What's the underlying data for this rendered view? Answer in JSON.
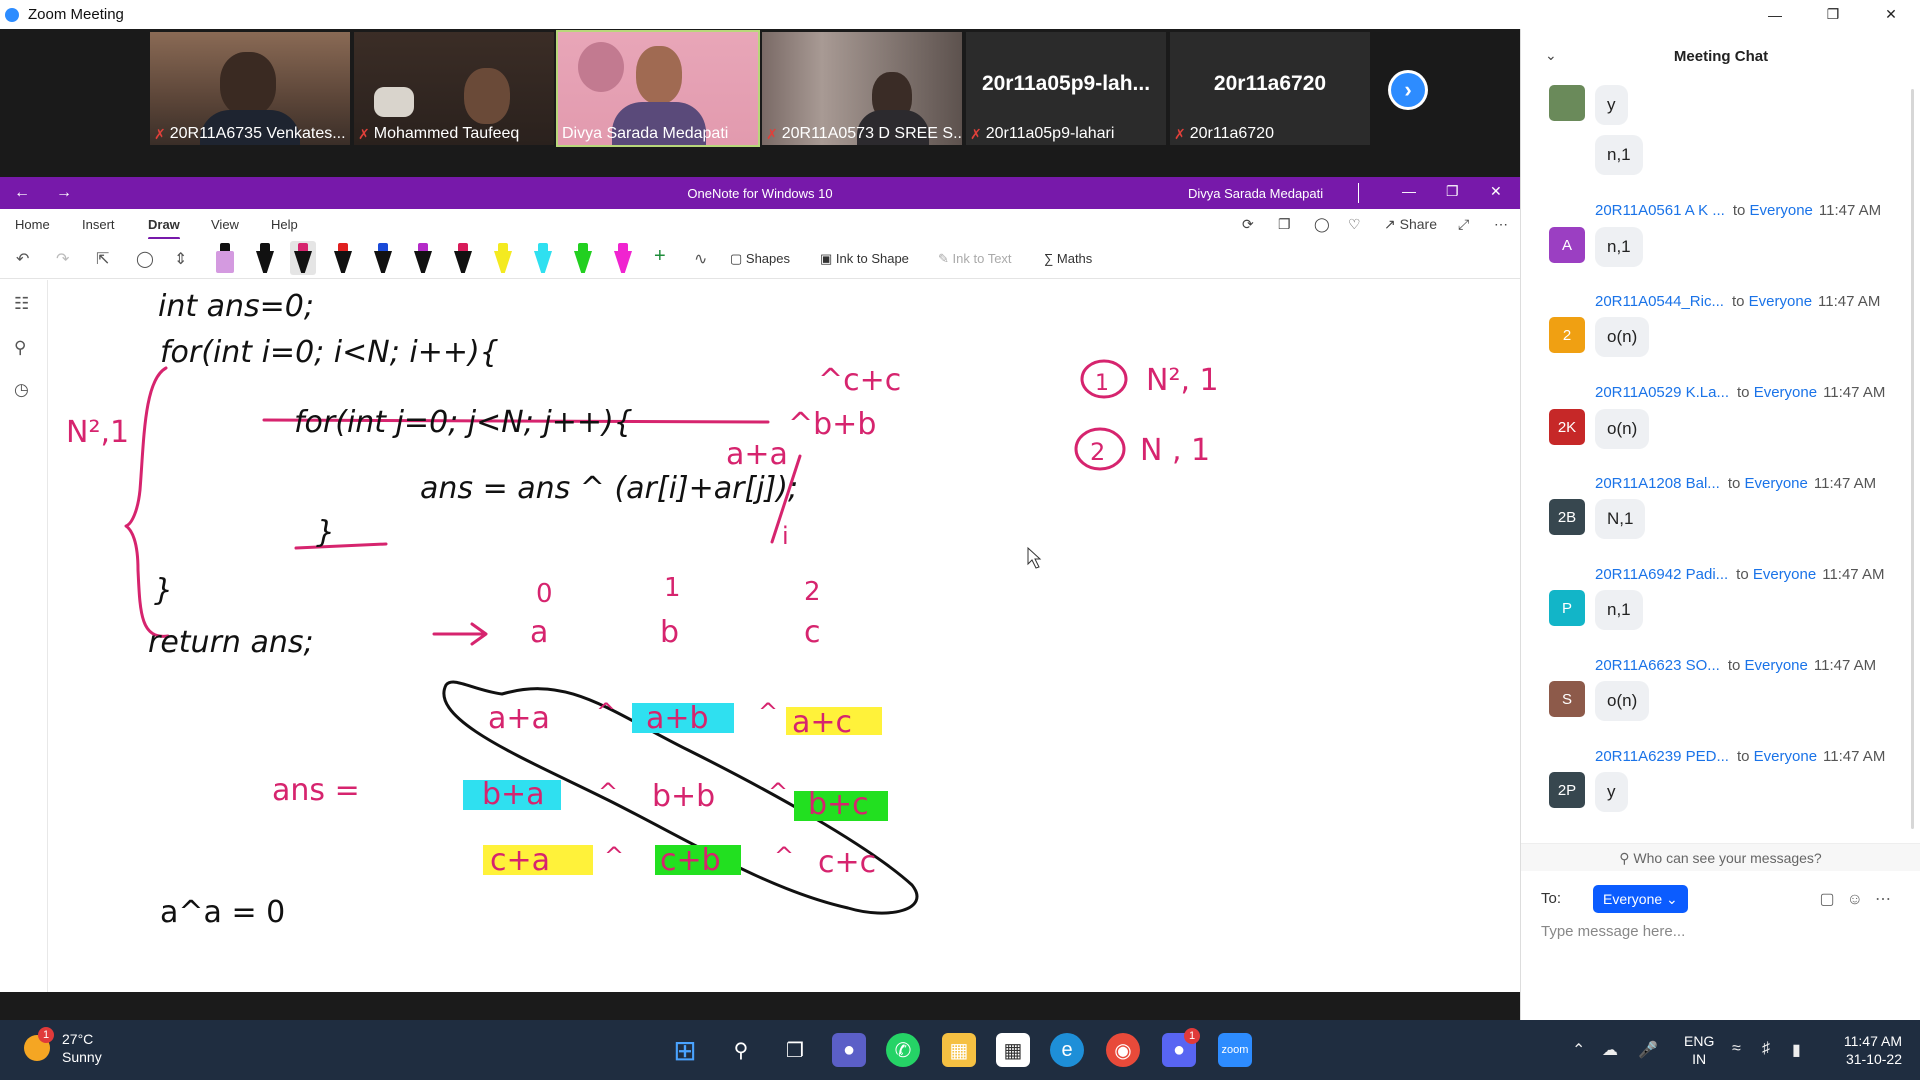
{
  "window": {
    "title": "Zoom Meeting"
  },
  "participants": [
    {
      "name": "20R11A6735 Venkates...",
      "muted": true,
      "video": true
    },
    {
      "name": "Mohammed Taufeeq",
      "muted": true,
      "video": true
    },
    {
      "name": "Divya Sarada Medapati",
      "muted": false,
      "video": true,
      "active_speaker": true
    },
    {
      "name": "20R11A0573 D SREE S...",
      "muted": true,
      "video": true
    },
    {
      "name": "20r11a05p9-lahari",
      "display": "20r11a05p9-lah...",
      "muted": true,
      "video": false
    },
    {
      "name": "20r11a6720",
      "display": "20r11a6720",
      "muted": true,
      "video": false
    }
  ],
  "onenote": {
    "title": "OneNote for Windows 10",
    "user": "Divya Sarada Medapati",
    "tabs": [
      "Home",
      "Insert",
      "Draw",
      "View",
      "Help"
    ],
    "active_tab": "Draw",
    "share_label": "Share",
    "tools": {
      "shapes": "Shapes",
      "ink_to_shape": "Ink to Shape",
      "ink_to_text": "Ink to Text",
      "maths": "Maths"
    }
  },
  "whiteboard": {
    "code": [
      "int ans=0;",
      "for(int i=0; i<N; i++){",
      "for(int j=0; j<N; j++){",
      "ans = ans ^ (ar[i]+ar[j]);",
      "}",
      "}",
      "return ans;"
    ],
    "left_note": "N²,1",
    "top_right_notes": [
      "^c+c",
      "^b+b",
      "a+a"
    ],
    "sub_i": "i",
    "options": [
      {
        "num": "1",
        "text": "N², 1"
      },
      {
        "num": "2",
        "text": "N , 1"
      }
    ],
    "arrow": "→",
    "indices": [
      {
        "i": "0",
        "v": "a"
      },
      {
        "i": "1",
        "v": "b"
      },
      {
        "i": "2",
        "v": "c"
      }
    ],
    "ans_label": "ans =",
    "matrix": [
      [
        "a+a",
        "a+b",
        "a+c"
      ],
      [
        "b+a",
        "b+b",
        "b+c"
      ],
      [
        "c+a",
        "c+b",
        "c+c"
      ]
    ],
    "xor": "^",
    "identity": "a^a = 0",
    "highlight_colors": {
      "cyan": "#2fe0f0",
      "yellow": "#fff23a",
      "green": "#22e020"
    },
    "ink_color": "#d6246e"
  },
  "chat": {
    "title": "Meeting Chat",
    "messages": [
      {
        "sender": "",
        "avatar": "",
        "avatar_color": "#6a8a5a",
        "to": "",
        "time": "",
        "texts": [
          "y",
          "n,1"
        ]
      },
      {
        "sender": "20R11A0561 A K ...",
        "avatar": "A",
        "avatar_color": "#9b3fc2",
        "to": "Everyone",
        "time": "11:47 AM",
        "texts": [
          "n,1"
        ]
      },
      {
        "sender": "20R11A0544_Ric...",
        "avatar": "2",
        "avatar_color": "#f0a012",
        "to": "Everyone",
        "time": "11:47 AM",
        "texts": [
          "o(n)"
        ]
      },
      {
        "sender": "20R11A0529 K.La...",
        "avatar": "2K",
        "avatar_color": "#c62828",
        "to": "Everyone",
        "time": "11:47 AM",
        "texts": [
          "o(n)"
        ]
      },
      {
        "sender": "20R11A1208 Bal...",
        "avatar": "2B",
        "avatar_color": "#37474f",
        "to": "Everyone",
        "time": "11:47 AM",
        "texts": [
          "N,1"
        ]
      },
      {
        "sender": "20R11A6942 Padi...",
        "avatar": "P",
        "avatar_color": "#12b5c8",
        "to": "Everyone",
        "time": "11:47 AM",
        "texts": [
          "n,1"
        ]
      },
      {
        "sender": "20R11A6623 SO...",
        "avatar": "S",
        "avatar_color": "#8d5a4a",
        "to": "Everyone",
        "time": "11:47 AM",
        "texts": [
          "o(n)"
        ]
      },
      {
        "sender": "20R11A6239 PED...",
        "avatar": "2P",
        "avatar_color": "#37474f",
        "to": "Everyone",
        "time": "11:47 AM",
        "texts": [
          "y"
        ]
      }
    ],
    "visibility": "Who can see your messages?",
    "to_label": "To:",
    "recipient": "Everyone",
    "placeholder": "Type message here..."
  },
  "taskbar": {
    "weather": {
      "temp": "27°C",
      "cond": "Sunny",
      "badge": "1"
    },
    "lang": {
      "top": "ENG",
      "bottom": "IN"
    },
    "time": "11:47 AM",
    "date": "31-10-22",
    "discord_badge": "1"
  }
}
